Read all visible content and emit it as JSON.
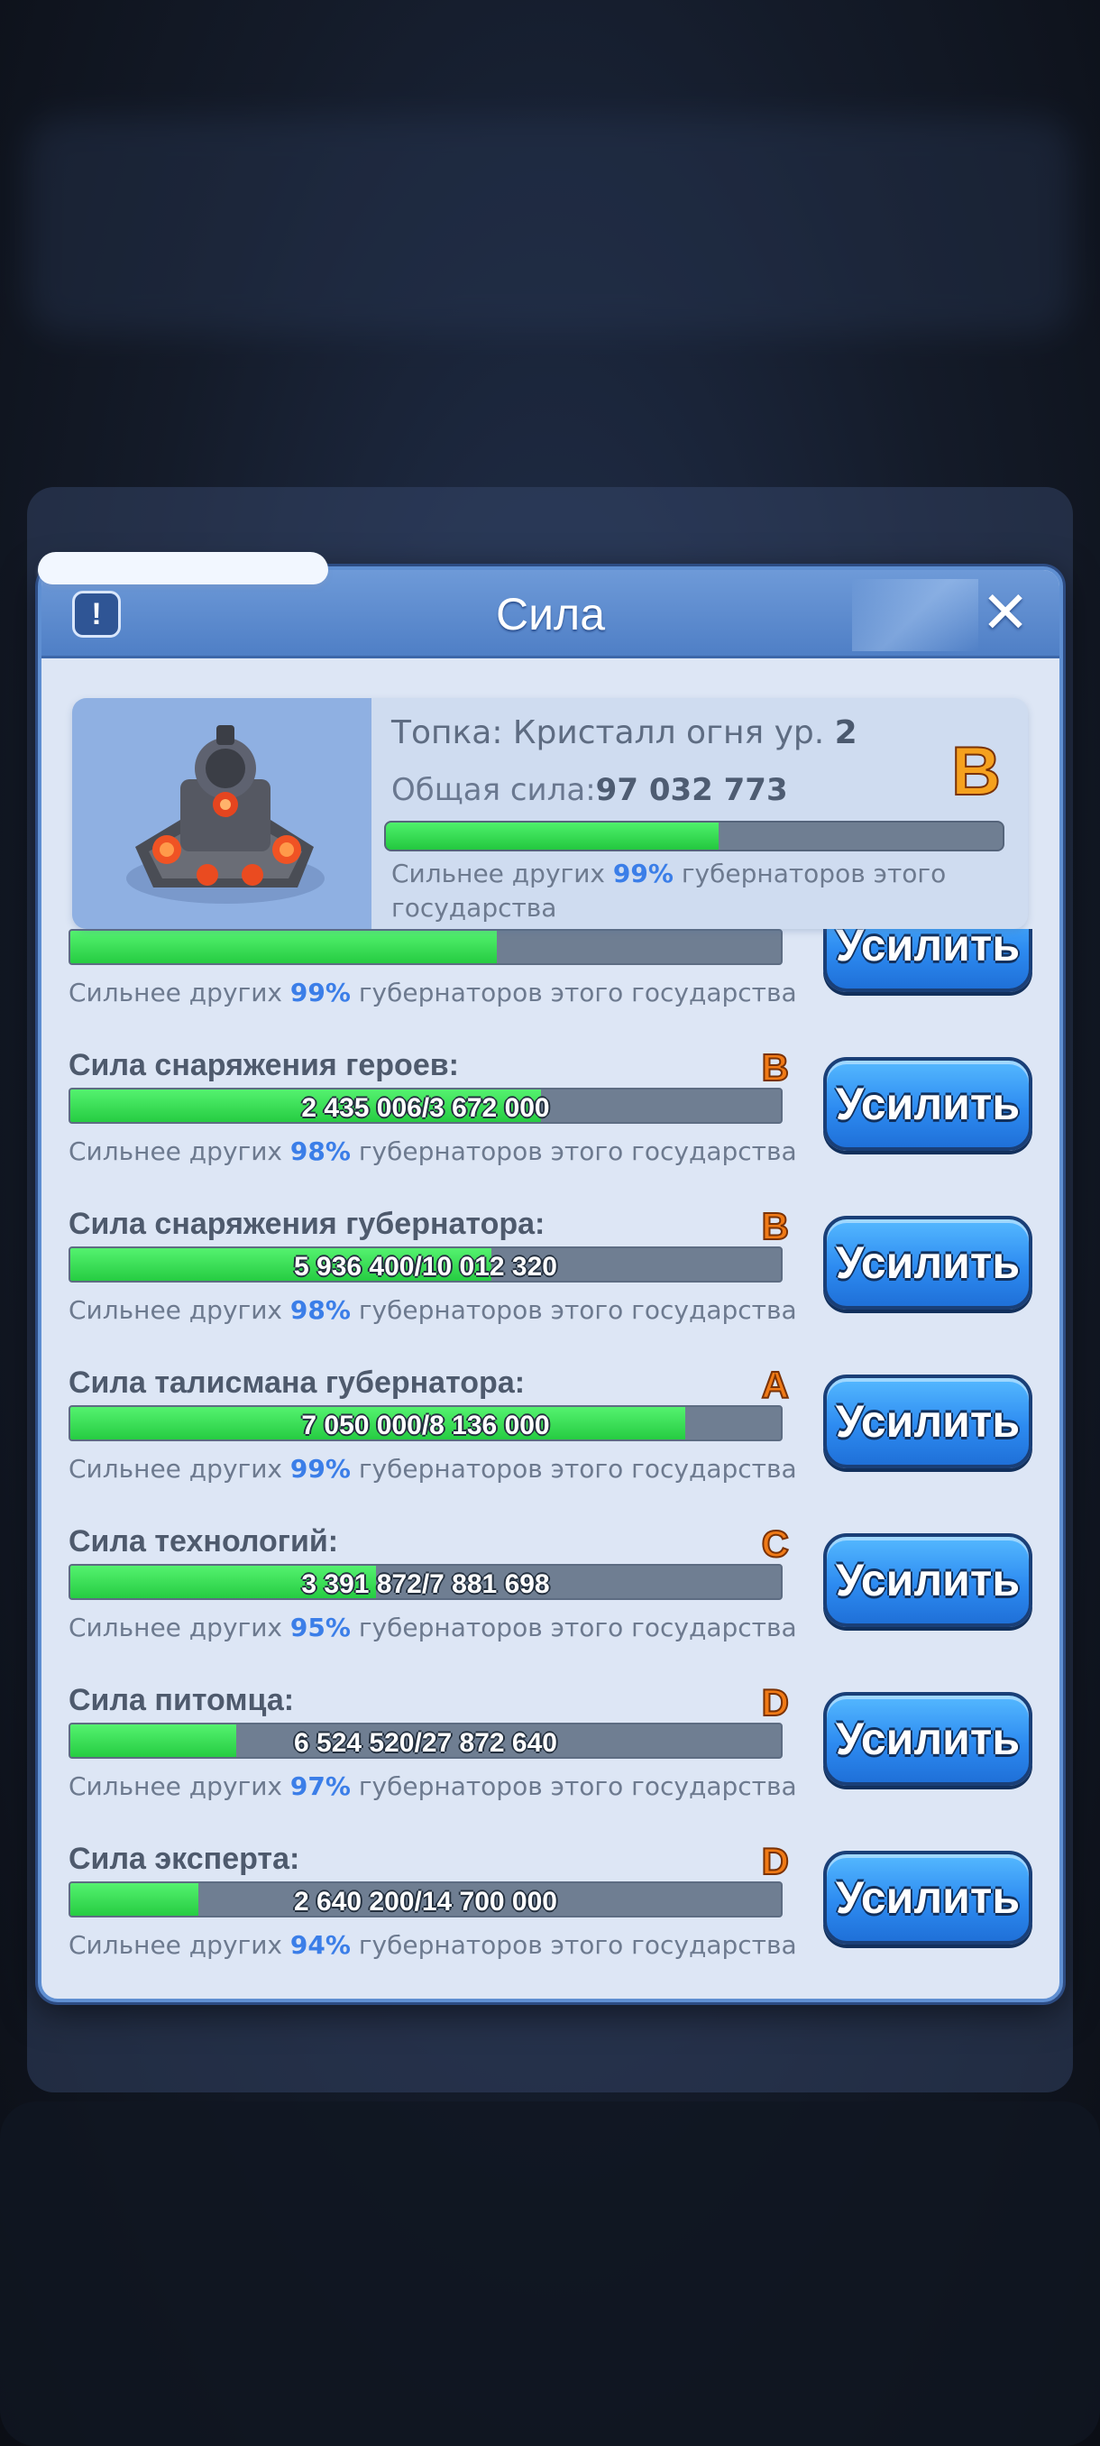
{
  "dialog": {
    "title": "Сила",
    "info_label": "!",
    "close_label": "✕"
  },
  "summary": {
    "building_prefix": "Топка: Кристалл огня ур.",
    "building_level": "2",
    "total_power_label": "Общая сила:",
    "total_power_value": "97 032 773",
    "grade": "B",
    "progress_fraction": 0.54,
    "desc_prefix": "Сильнее других",
    "desc_pct": "99%",
    "desc_suffix": "губернаторов этого государства"
  },
  "rows": [
    {
      "name": "",
      "grade": "",
      "value": "",
      "fill": 0.6,
      "desc_prefix": "Сильнее других",
      "desc_pct": "99%",
      "desc_suffix": "губернаторов этого государства",
      "button": "Усилить"
    },
    {
      "name": "Сила снаряжения героев:",
      "grade": "B",
      "value": "2 435 006/3 672 000",
      "fill": 0.663,
      "desc_prefix": "Сильнее других",
      "desc_pct": "98%",
      "desc_suffix": "губернаторов этого государства",
      "button": "Усилить"
    },
    {
      "name": "Сила снаряжения губернатора:",
      "grade": "B",
      "value": "5 936 400/10 012 320",
      "fill": 0.593,
      "desc_prefix": "Сильнее других",
      "desc_pct": "98%",
      "desc_suffix": "губернаторов этого государства",
      "button": "Усилить"
    },
    {
      "name": "Сила талисмана губернатора:",
      "grade": "A",
      "value": "7 050 000/8 136 000",
      "fill": 0.866,
      "desc_prefix": "Сильнее других",
      "desc_pct": "99%",
      "desc_suffix": "губернаторов этого государства",
      "button": "Усилить"
    },
    {
      "name": "Сила технологий:",
      "grade": "C",
      "value": "3 391 872/7 881 698",
      "fill": 0.43,
      "desc_prefix": "Сильнее других",
      "desc_pct": "95%",
      "desc_suffix": "губернаторов этого государства",
      "button": "Усилить"
    },
    {
      "name": "Сила питомца:",
      "grade": "D",
      "value": "6 524 520/27 872 640",
      "fill": 0.234,
      "desc_prefix": "Сильнее других",
      "desc_pct": "97%",
      "desc_suffix": "губернаторов этого государства",
      "button": "Усилить"
    },
    {
      "name": "Сила эксперта:",
      "grade": "D",
      "value": "2 640 200/14 700 000",
      "fill": 0.18,
      "desc_prefix": "Сильнее других",
      "desc_pct": "94%",
      "desc_suffix": "губернаторов этого государства",
      "button": "Усилить"
    }
  ],
  "colors": {
    "accent_blue": "#3b7ee8",
    "grade_orange": "#f07a16",
    "progress_green": "#2ee04d"
  }
}
